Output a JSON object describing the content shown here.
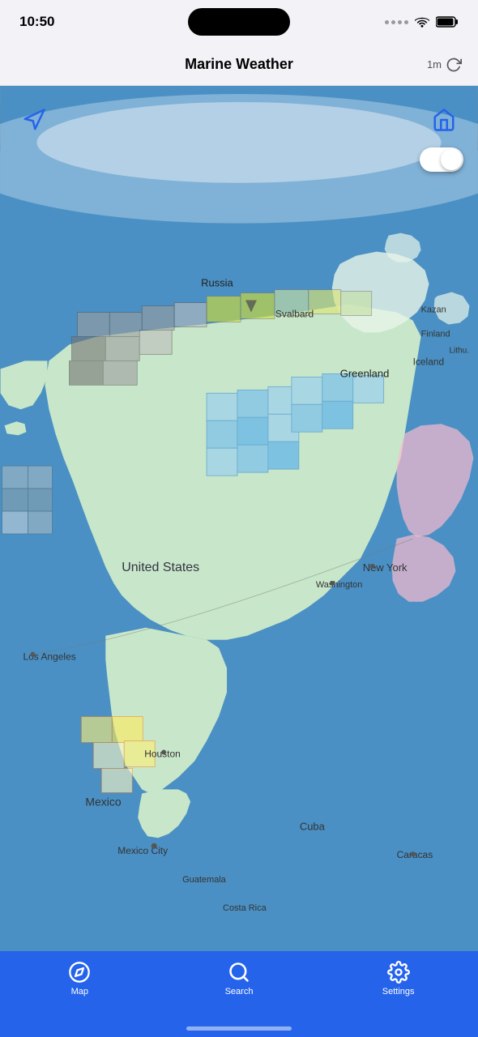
{
  "statusBar": {
    "time": "10:50",
    "icons": {
      "wifi": "wifi-icon",
      "battery": "battery-icon",
      "signal": "signal-icon"
    }
  },
  "navHeader": {
    "title": "Marine Weather",
    "refreshTime": "1m",
    "refreshLabel": "refresh"
  },
  "map": {
    "locationBtn": "location-button",
    "homeBtn": "home-button",
    "toggleBtn": "layer-toggle",
    "labels": {
      "russia": "Russia",
      "svalbard": "Svalbard",
      "greenland": "Greenland",
      "iceland": "Iceland",
      "finland": "Finland",
      "lithuania": "Lithu.",
      "kazan": "Kazan",
      "canada": "",
      "unitedStates": "United States",
      "newYork": "New York",
      "washington": "Washington",
      "losAngeles": "Los Angeles",
      "houston": "Houston",
      "mexico": "Mexico",
      "mexicoCity": "Mexico City",
      "guatemala": "Guatemala",
      "costaRica": "Costa Rica",
      "cuba": "Cuba",
      "caracas": "Caracas"
    }
  },
  "tabBar": {
    "tabs": [
      {
        "id": "map",
        "label": "Map",
        "icon": "compass-icon",
        "active": false
      },
      {
        "id": "search",
        "label": "Search",
        "icon": "search-icon",
        "active": true
      },
      {
        "id": "settings",
        "label": "Settings",
        "icon": "gear-icon",
        "active": false
      }
    ]
  }
}
